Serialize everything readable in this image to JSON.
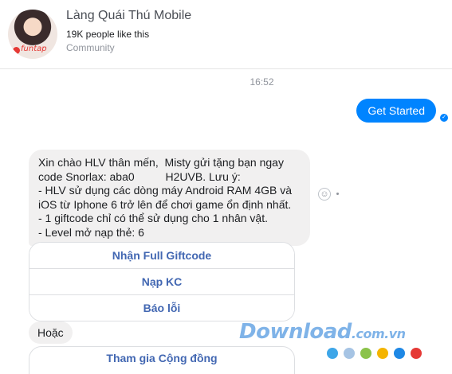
{
  "header": {
    "page_name": "Làng Quái Thú Mobile",
    "likes": "19K people like this",
    "category": "Community",
    "avatar_logo_text": "funtap"
  },
  "timestamp": "16:52",
  "outgoing": {
    "text": "Get Started",
    "seen_icon": "check-icon"
  },
  "incoming_message": {
    "text": "Xin chào HLV thân mến,  Misty gửi tặng bạn ngay\ncode Snorlax: aba0          H2UVB. Lưu ý:\n- HLV sử dụng các dòng máy Android RAM 4GB và\niOS từ Iphone 6 trở lên để chơi game ổn định nhất.\n- 1 giftcode chỉ có thể sử dụng cho 1 nhân vật.\n- Level mở nạp thẻ: 6"
  },
  "quick_replies": [
    {
      "label": "Nhận Full Giftcode"
    },
    {
      "label": "Nạp KC"
    },
    {
      "label": "Báo lỗi"
    }
  ],
  "message2": {
    "text": "Hoặc"
  },
  "quick_replies_2": [
    {
      "label": "Tham gia Cộng đồng"
    }
  ],
  "watermark": {
    "brand": "Download",
    "tld": ".com.vn",
    "dot_colors": [
      "#3ea6e8",
      "#a6c4e4",
      "#8bc34a",
      "#f4b400",
      "#1e88e5",
      "#e53935"
    ]
  },
  "colors": {
    "accent": "#0084ff",
    "button_text": "#4267b2",
    "bubble_bg": "#f1f0f0"
  }
}
